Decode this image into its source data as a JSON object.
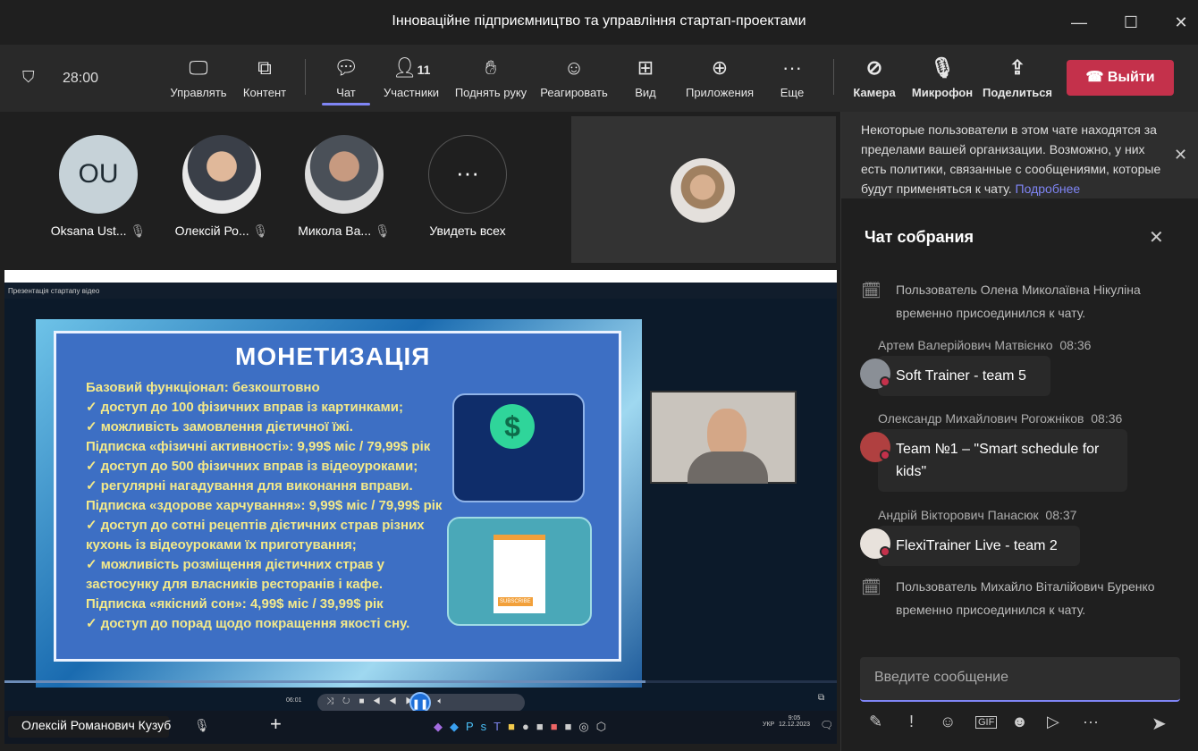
{
  "window": {
    "title": "Інноваційне підприємництво та управління стартап-проектами"
  },
  "toolbar": {
    "timer": "28:00",
    "items": [
      {
        "label": "Управлять",
        "icon": "share-screen-cursor-icon"
      },
      {
        "label": "Контент",
        "icon": "share-content-icon"
      },
      {
        "label": "Чат",
        "icon": "chat-icon"
      },
      {
        "label": "Участники",
        "icon": "people-icon",
        "count": "11"
      },
      {
        "label": "Поднять руку",
        "icon": "raise-hand-icon"
      },
      {
        "label": "Реагировать",
        "icon": "smile-icon"
      },
      {
        "label": "Вид",
        "icon": "grid-view-icon"
      },
      {
        "label": "Приложения",
        "icon": "add-app-icon"
      },
      {
        "label": "Еще",
        "icon": "more-icon"
      },
      {
        "label": "Камера",
        "icon": "camera-off-icon"
      },
      {
        "label": "Микрофон",
        "icon": "mic-off-icon"
      },
      {
        "label": "Поделиться",
        "icon": "share-icon"
      }
    ],
    "leave_label": "Выйти",
    "accent": "#7f85f5",
    "leave_color": "#c4314b"
  },
  "participants": [
    {
      "initials": "OU",
      "name": "Oksana Ust..."
    },
    {
      "name": "Олексій Ро..."
    },
    {
      "name": "Микола Ва..."
    },
    {
      "name": "Увидеть всех"
    }
  ],
  "shared": {
    "window_title": "Презентація стартапу відео",
    "slide_title": "МОНЕТИЗАЦІЯ",
    "lines": [
      "Базовий функціонал: безкоштовно",
      "✓   доступ до 100 фізичних вправ із картинками;",
      "✓   можливість замовлення дієтичної їжі.",
      "Підписка «фізичні активності»: 9,99$ міс / 79,99$ рік",
      "✓   доступ до 500 фізичних вправ із відеоуроками;",
      "✓   регулярні нагадування для виконання вправи.",
      "Підписка «здорове харчування»: 9,99$ міс / 79,99$ рік",
      "✓   доступ до сотні рецептів дієтичних страв різних",
      "кухонь із відеоуроками їх приготування;",
      "✓   можливість розміщення дієтичних страв у",
      "застосунку для власників ресторанів і кафе.",
      "Підписка «якісний сон»: 4,99$ міс / 39,99$ рік",
      "✓   доступ до порад щодо покращення якості сну."
    ],
    "subscribe": "SUBSCRIBE",
    "player_time": "06:01",
    "progress": 0.77,
    "presenter": "Олексій Романович Кузуб",
    "tray_lang": "УКР",
    "tray_time": "9:05",
    "tray_date": "12.12.2023"
  },
  "chat": {
    "banner_text": "Некоторые пользователи в этом чате находятся за пределами вашей организации. Возможно, у них есть политики, связанные с сообщениями, которые будут применяться к чату.",
    "banner_link": "Подробнее",
    "title": "Чат собрания",
    "sys1": "Пользователь Олена Миколаївна Нікуліна временно присоединился к чату.",
    "messages": [
      {
        "sender": "Артем Валерійович Матвієнко",
        "time": "08:36",
        "text": "Soft Trainer - team 5"
      },
      {
        "sender": "Олександр Михайлович Рогожніков",
        "time": "08:36",
        "text": "Team №1 – \"Smart schedule for kids\""
      },
      {
        "sender": "Андрій Вікторович Панасюк",
        "time": "08:37",
        "text": "FlexiTrainer Live - team 2"
      }
    ],
    "sys2": "Пользователь Михайло Віталійович Буренко временно присоединился к чату.",
    "input_placeholder": "Введите сообщение"
  }
}
